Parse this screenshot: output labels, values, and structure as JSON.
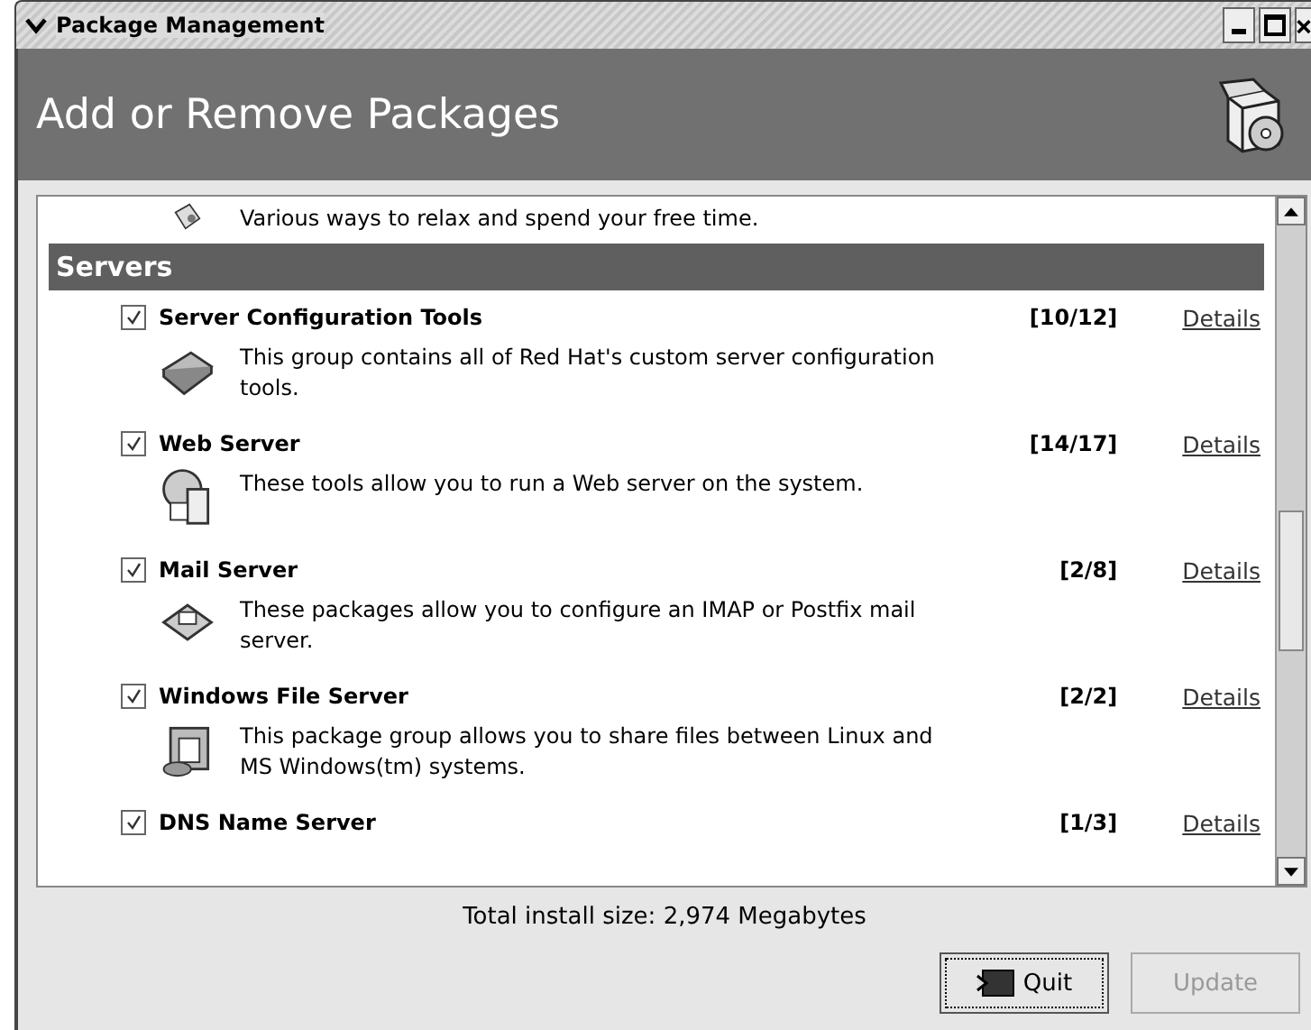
{
  "window": {
    "title": "Package Management"
  },
  "header": {
    "title": "Add or Remove Packages"
  },
  "partial_group": {
    "description": "Various ways to relax and spend your free time."
  },
  "category": {
    "title": "Servers"
  },
  "groups": [
    {
      "name": "Server Configuration Tools",
      "checked": true,
      "count": "[10/12]",
      "details": "Details",
      "description": "This group contains all of Red Hat's custom server configuration tools."
    },
    {
      "name": "Web Server",
      "checked": true,
      "count": "[14/17]",
      "details": "Details",
      "description": "These tools allow you to run a Web server on the system."
    },
    {
      "name": "Mail Server",
      "checked": true,
      "count": "[2/8]",
      "details": "Details",
      "description": "These packages allow you to configure an IMAP or Postfix mail server."
    },
    {
      "name": "Windows File Server",
      "checked": true,
      "count": "[2/2]",
      "details": "Details",
      "description": "This package group allows you to share files between Linux and MS Windows(tm) systems."
    },
    {
      "name": "DNS Name Server",
      "checked": true,
      "count": "[1/3]",
      "details": "Details"
    }
  ],
  "total": "Total install size: 2,974 Megabytes",
  "buttons": [
    {
      "label": "Quit",
      "disabled": false,
      "kind": "quit"
    },
    {
      "label": "Update",
      "disabled": true,
      "kind": "update"
    }
  ]
}
